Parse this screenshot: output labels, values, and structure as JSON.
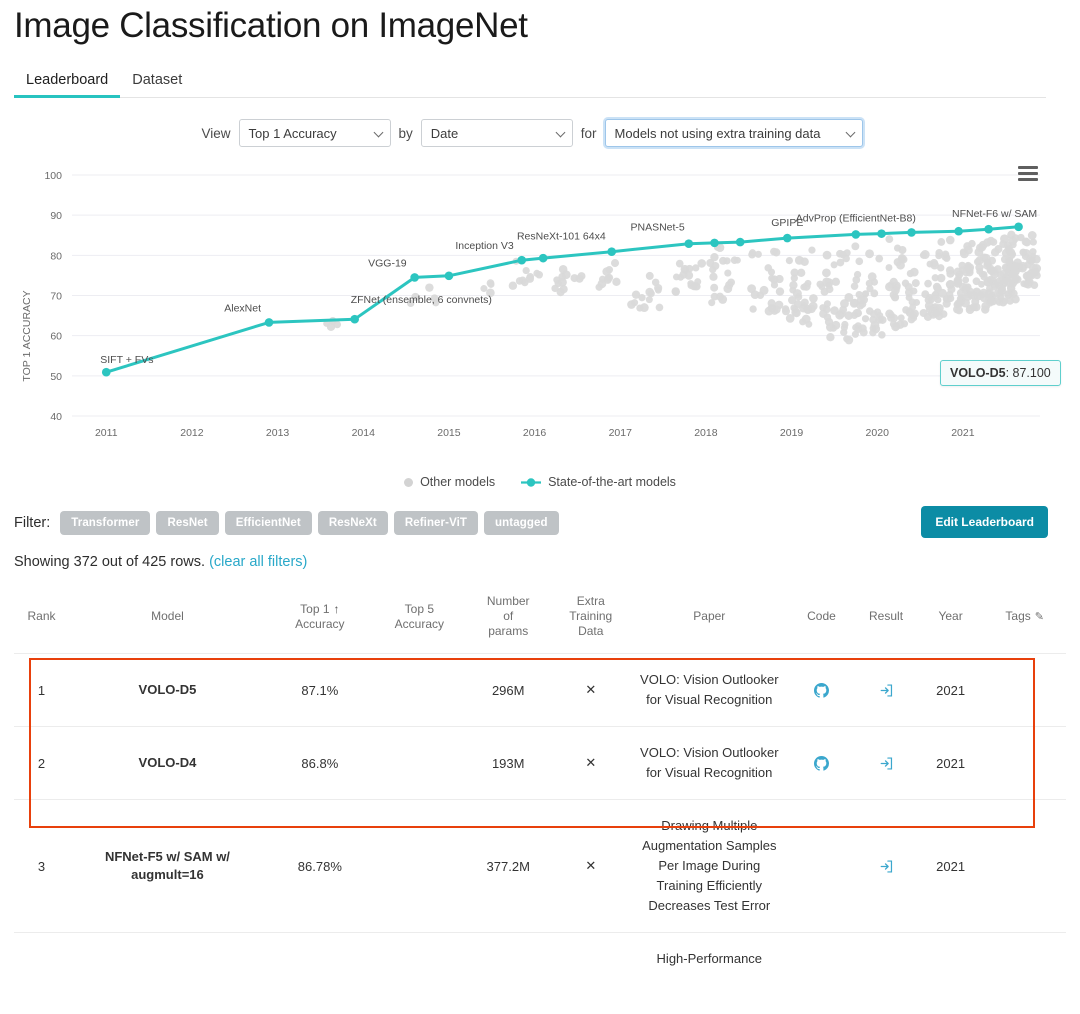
{
  "header": {
    "title": "Image Classification on ImageNet",
    "tabs": [
      {
        "label": "Leaderboard",
        "active": true
      },
      {
        "label": "Dataset",
        "active": false
      }
    ]
  },
  "controls": {
    "view_label": "View",
    "view_value": "Top 1 Accuracy",
    "by_label": "by",
    "by_value": "Date",
    "for_label": "for",
    "for_value": "Models not using extra training data"
  },
  "chart_tooltip": {
    "model": "VOLO-D5",
    "separator": ": ",
    "value": "87.100"
  },
  "menu_icon": "hamburger-menu-icon",
  "legend": {
    "other": "Other models",
    "sota": "State-of-the-art models"
  },
  "filters": {
    "label": "Filter:",
    "chips": [
      "Transformer",
      "ResNet",
      "EfficientNet",
      "ResNeXt",
      "Refiner-ViT",
      "untagged"
    ],
    "edit_button": "Edit Leaderboard"
  },
  "showing": {
    "text": "Showing 372 out of 425 rows.",
    "clear_link": "(clear all filters)"
  },
  "table": {
    "headers": {
      "rank": "Rank",
      "model": "Model",
      "top1_line1": "Top 1",
      "top1_line2": "Accuracy",
      "top1_sort": "↑",
      "top5_line1": "Top 5",
      "top5_line2": "Accuracy",
      "params_line1": "Number",
      "params_line2": "of",
      "params_line3": "params",
      "extra_line1": "Extra",
      "extra_line2": "Training",
      "extra_line3": "Data",
      "paper": "Paper",
      "code": "Code",
      "result": "Result",
      "year": "Year",
      "tags": "Tags",
      "tags_edit_icon": "edit-icon"
    },
    "rows": [
      {
        "rank": "1",
        "model": "VOLO-D5",
        "top1": "87.1%",
        "top5": "",
        "params": "296M",
        "extra": "✕",
        "paper": "VOLO: Vision Outlooker for Visual Recognition",
        "code_icon": "github-icon",
        "has_code": true,
        "result_icon": "result-link-icon",
        "year": "2021",
        "tags": ""
      },
      {
        "rank": "2",
        "model": "VOLO-D4",
        "top1": "86.8%",
        "top5": "",
        "params": "193M",
        "extra": "✕",
        "paper": "VOLO: Vision Outlooker for Visual Recognition",
        "code_icon": "github-icon",
        "has_code": true,
        "result_icon": "result-link-icon",
        "year": "2021",
        "tags": ""
      },
      {
        "rank": "3",
        "model": "NFNet-F5 w/ SAM w/ augmult=16",
        "top1": "86.78%",
        "top5": "",
        "params": "377.2M",
        "extra": "✕",
        "paper": "Drawing Multiple Augmentation Samples Per Image During Training Efficiently Decreases Test Error",
        "code_icon": "",
        "has_code": false,
        "result_icon": "result-link-icon",
        "year": "2021",
        "tags": ""
      },
      {
        "rank": "",
        "model": "",
        "top1": "",
        "top5": "",
        "params": "",
        "extra": "",
        "paper": "High-Performance",
        "code_icon": "",
        "has_code": false,
        "result_icon": "",
        "year": "",
        "tags": ""
      }
    ]
  },
  "colors": {
    "accent_teal": "#27c3c0",
    "sota_line": "#2cc5c0",
    "other_points": "#d4d4d4",
    "link_blue": "#2f9dc4",
    "edit_button": "#0c8ca5",
    "highlight_border": "#e8400c",
    "chip_gray": "#bfc3c6"
  },
  "chart_data": {
    "type": "line",
    "title": "",
    "xlabel": "",
    "ylabel": "TOP 1 ACCURACY",
    "xlim": [
      2010.6,
      2021.9
    ],
    "ylim": [
      40,
      100
    ],
    "yticks": [
      40,
      50,
      60,
      70,
      80,
      90,
      100
    ],
    "xticks": [
      2011,
      2012,
      2013,
      2014,
      2015,
      2016,
      2017,
      2018,
      2019,
      2020,
      2021
    ],
    "grid": true,
    "legend_position": "bottom",
    "series": [
      {
        "name": "State-of-the-art models",
        "type": "line",
        "color": "#2cc5c0",
        "points": [
          {
            "x": 2011.0,
            "y": 50.9,
            "label": "SIFT + FVs"
          },
          {
            "x": 2012.9,
            "y": 63.3,
            "label": "AlexNet"
          },
          {
            "x": 2013.9,
            "y": 64.1,
            "label": "ZFNet (ensemble, 6 convnets)"
          },
          {
            "x": 2014.6,
            "y": 74.5,
            "label": "VGG-19"
          },
          {
            "x": 2015.0,
            "y": 74.9,
            "label": ""
          },
          {
            "x": 2015.85,
            "y": 78.8,
            "label": "Inception V3"
          },
          {
            "x": 2016.1,
            "y": 79.3,
            "label": ""
          },
          {
            "x": 2016.9,
            "y": 80.9,
            "label": "ResNeXt-101 64x4"
          },
          {
            "x": 2017.8,
            "y": 82.9,
            "label": "PNASNet-5"
          },
          {
            "x": 2018.1,
            "y": 83.1,
            "label": ""
          },
          {
            "x": 2018.4,
            "y": 83.3,
            "label": ""
          },
          {
            "x": 2018.95,
            "y": 84.3,
            "label": "GPIPE"
          },
          {
            "x": 2019.75,
            "y": 85.2,
            "label": "AdvProp (EfficientNet-B8)"
          },
          {
            "x": 2020.05,
            "y": 85.4,
            "label": ""
          },
          {
            "x": 2020.4,
            "y": 85.7,
            "label": ""
          },
          {
            "x": 2020.95,
            "y": 86.0,
            "label": ""
          },
          {
            "x": 2021.3,
            "y": 86.5,
            "label": "NFNet-F6 w/ SAM"
          },
          {
            "x": 2021.65,
            "y": 87.1,
            "label": "VOLO-D5"
          }
        ]
      },
      {
        "name": "Other models",
        "type": "scatter",
        "color": "#d4d4d4",
        "note": "dense gray cloud of non-SOTA submissions, density increasing 2017-2021, accuracy mostly 60-86"
      }
    ]
  }
}
